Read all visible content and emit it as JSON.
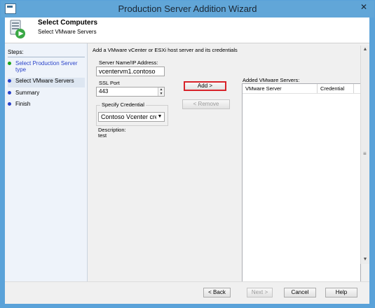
{
  "window": {
    "title": "Production Server Addition Wizard",
    "close_glyph": "✕"
  },
  "header": {
    "title": "Select Computers",
    "subtitle": "Select VMware Servers",
    "icon": "server-setup-icon"
  },
  "steps": {
    "label": "Steps:",
    "items": [
      {
        "label": "Select Production Server type",
        "state": "completed",
        "color": "#1aa31a"
      },
      {
        "label": "Select VMware Servers",
        "state": "current",
        "color": "#2a43c9"
      },
      {
        "label": "Summary",
        "state": "pending",
        "color": "#2a43c9"
      },
      {
        "label": "Finish",
        "state": "pending",
        "color": "#2a43c9"
      }
    ]
  },
  "main": {
    "description": "Add a VMware vCenter or ESXi host server and its credentials",
    "server_name_label": "Server Name/IP Address:",
    "server_name_value": "vcentervm1.contoso",
    "ssl_port_label": "SSL Port",
    "ssl_port_value": "443",
    "credential_group_label": "Specify Credential",
    "credential_value": "Contoso Vcenter cre",
    "description_label": "Description:",
    "description_value": "test",
    "add_button": "Add >",
    "remove_button": "< Remove"
  },
  "added_servers": {
    "label": "Added VMware Servers:",
    "columns": [
      "VMware Server",
      "Credential"
    ],
    "rows": []
  },
  "footer": {
    "back": "< Back",
    "next": "Next >",
    "cancel": "Cancel",
    "help": "Help"
  },
  "colors": {
    "titlebar": "#61a6d8",
    "highlight": "#d8232a"
  }
}
